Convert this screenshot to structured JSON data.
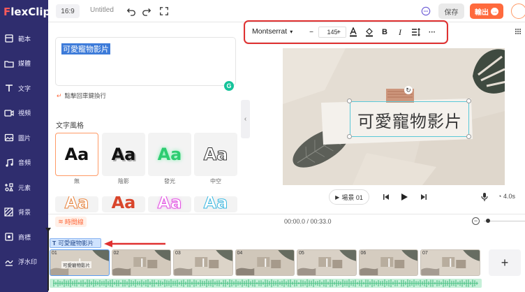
{
  "app": {
    "logo": "FlexClip",
    "ratio": "16:9",
    "title": "Untitled",
    "save_label": "保存",
    "export_label": "輸出"
  },
  "sidebar": {
    "items": [
      {
        "label": "範本",
        "icon": "template-icon"
      },
      {
        "label": "媒體",
        "icon": "folder-icon"
      },
      {
        "label": "文字",
        "icon": "text-icon"
      },
      {
        "label": "視頻",
        "icon": "video-icon"
      },
      {
        "label": "圖片",
        "icon": "image-icon"
      },
      {
        "label": "音頻",
        "icon": "music-icon"
      },
      {
        "label": "元素",
        "icon": "elements-icon"
      },
      {
        "label": "背景",
        "icon": "background-icon"
      },
      {
        "label": "商標",
        "icon": "brand-icon"
      },
      {
        "label": "浮水印",
        "icon": "watermark-icon"
      }
    ]
  },
  "panel": {
    "text_value": "可愛寵物影片",
    "hint": "點擊回車鍵換行",
    "style_section_title": "文字風格",
    "styles": [
      {
        "label": "無",
        "sample": "Aa"
      },
      {
        "label": "陰影",
        "sample": "Aa"
      },
      {
        "label": "發光",
        "sample": "Aa"
      },
      {
        "label": "中空",
        "sample": "Aa"
      }
    ],
    "styles_row2": [
      "Aa",
      "Aa",
      "Aa",
      "Aa"
    ]
  },
  "format_toolbar": {
    "font": "Montserrat",
    "font_size": "145",
    "minus": "−",
    "plus": "+",
    "bold": "B",
    "italic": "I",
    "more": "···"
  },
  "preview": {
    "text": "可愛寵物影片",
    "scene_label": "場景 01",
    "speed": "4.0s"
  },
  "timeline": {
    "tab_label": "時間線",
    "time": "00:00.0 / 00:33.0",
    "text_track_label": "可愛寵物影片",
    "clips": [
      "01",
      "02",
      "03",
      "04",
      "05",
      "06",
      "07"
    ],
    "first_clip_caption": "可愛寵物影片",
    "add_label": "+"
  },
  "colors": {
    "sidebar_bg": "#2f2d6e",
    "accent": "#ff6a3d",
    "highlight_red": "#e03131",
    "selection_blue": "#3d7bd9"
  }
}
